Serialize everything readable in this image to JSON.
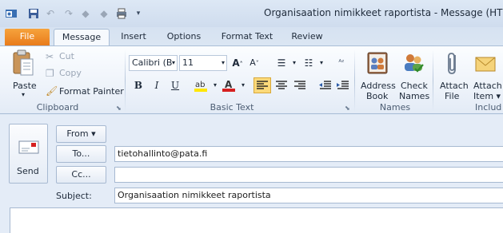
{
  "window": {
    "title": "Organisaation nimikkeet raportista  -  Message (HTML)"
  },
  "quick_access": {
    "icons": [
      "outlook-icon",
      "save-icon",
      "undo-icon",
      "redo-icon",
      "up-icon",
      "down-icon",
      "print-icon",
      "customize-icon"
    ]
  },
  "tabs": [
    {
      "label": "File"
    },
    {
      "label": "Message"
    },
    {
      "label": "Insert"
    },
    {
      "label": "Options"
    },
    {
      "label": "Format Text"
    },
    {
      "label": "Review"
    }
  ],
  "ribbon": {
    "clipboard": {
      "label": "Clipboard",
      "paste": "Paste",
      "cut": "Cut",
      "copy": "Copy",
      "format_painter": "Format Painter"
    },
    "basic_text": {
      "label": "Basic Text",
      "font_name": "Calibri (B",
      "font_size": "11",
      "bold": "B",
      "italic": "I",
      "underline": "U"
    },
    "names": {
      "label": "Names",
      "address_book_line1": "Address",
      "address_book_line2": "Book",
      "check_names_line1": "Check",
      "check_names_line2": "Names"
    },
    "include": {
      "label": "Includ",
      "attach_file_line1": "Attach",
      "attach_file_line2": "File",
      "attach_item_line1": "Attach",
      "attach_item_line2": "Item ▾"
    }
  },
  "compose": {
    "send": "Send",
    "from": "From ▾",
    "to_button": "To...",
    "to_value": "tietohallinto@pata.fi",
    "cc_button": "Cc...",
    "cc_value": "",
    "subject_label": "Subject:",
    "subject_value": "Organisaation nimikkeet raportista"
  },
  "colors": {
    "file_tab": "#e8791a",
    "ribbon_bg": "#eef3fa",
    "highlight": "#ffe700",
    "font_color": "#d62020",
    "active_align": "#fbd97a"
  }
}
